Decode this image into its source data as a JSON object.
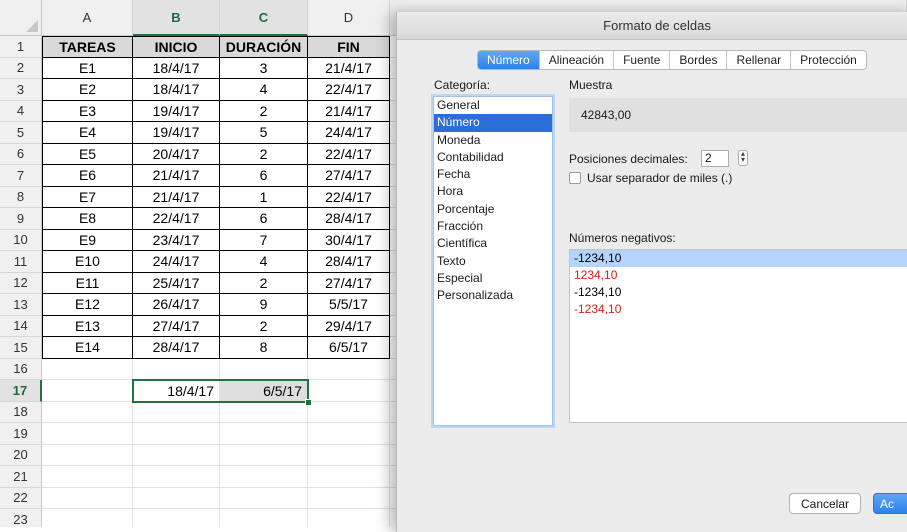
{
  "spreadsheet": {
    "columns": [
      "A",
      "B",
      "C",
      "D"
    ],
    "rows": [
      "1",
      "2",
      "3",
      "4",
      "5",
      "6",
      "7",
      "8",
      "9",
      "10",
      "11",
      "12",
      "13",
      "14",
      "15",
      "16",
      "17",
      "18",
      "19",
      "20",
      "21",
      "22",
      "23"
    ],
    "headers": [
      "TAREAS",
      "INICIO",
      "DURACIÓN",
      "FIN"
    ],
    "data": [
      [
        "E1",
        "18/4/17",
        "3",
        "21/4/17"
      ],
      [
        "E2",
        "18/4/17",
        "4",
        "22/4/17"
      ],
      [
        "E3",
        "19/4/17",
        "2",
        "21/4/17"
      ],
      [
        "E4",
        "19/4/17",
        "5",
        "24/4/17"
      ],
      [
        "E5",
        "20/4/17",
        "2",
        "22/4/17"
      ],
      [
        "E6",
        "21/4/17",
        "6",
        "27/4/17"
      ],
      [
        "E7",
        "21/4/17",
        "1",
        "22/4/17"
      ],
      [
        "E8",
        "22/4/17",
        "6",
        "28/4/17"
      ],
      [
        "E9",
        "23/4/17",
        "7",
        "30/4/17"
      ],
      [
        "E10",
        "24/4/17",
        "4",
        "28/4/17"
      ],
      [
        "E11",
        "25/4/17",
        "2",
        "27/4/17"
      ],
      [
        "E12",
        "26/4/17",
        "9",
        "5/5/17"
      ],
      [
        "E13",
        "27/4/17",
        "2",
        "29/4/17"
      ],
      [
        "E14",
        "28/4/17",
        "8",
        "6/5/17"
      ]
    ],
    "row17": {
      "b": "18/4/17",
      "c": "6/5/17"
    },
    "selected_columns": [
      "B",
      "C"
    ],
    "selected_row": "17",
    "selection_color": "#217346"
  },
  "dialog": {
    "title": "Formato de celdas",
    "tabs": [
      "Número",
      "Alineación",
      "Fuente",
      "Bordes",
      "Rellenar",
      "Protección"
    ],
    "active_tab": "Número",
    "category_label": "Categoría:",
    "categories": [
      "General",
      "Número",
      "Moneda",
      "Contabilidad",
      "Fecha",
      "Hora",
      "Porcentaje",
      "Fracción",
      "Científica",
      "Texto",
      "Especial",
      "Personalizada"
    ],
    "selected_category": "Número",
    "sample_label": "Muestra",
    "sample_value": "42843,00",
    "decimals_label": "Posiciones decimales:",
    "decimals_value": "2",
    "thousands_label": "Usar separador de miles (.)",
    "thousands_checked": false,
    "negatives_label": "Números negativos:",
    "negative_formats": [
      {
        "text": "-1234,10",
        "color": "#000000",
        "selected": true
      },
      {
        "text": "1234,10",
        "color": "#d8201c",
        "selected": false
      },
      {
        "text": "-1234,10",
        "color": "#000000",
        "selected": false
      },
      {
        "text": "-1234,10",
        "color": "#d8201c",
        "selected": false
      }
    ],
    "cancel_label": "Cancelar",
    "accept_label": "Ac",
    "accent_color": "#2d81ea"
  }
}
